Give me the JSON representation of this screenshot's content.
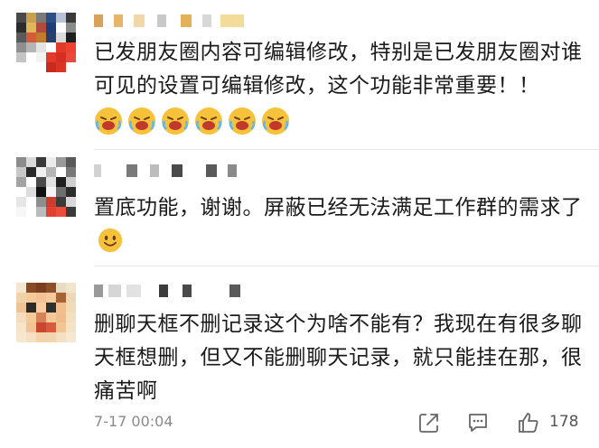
{
  "comments": [
    {
      "text": "已发朋友圈内容可编辑修改，特别是已发朋友圈对谁可见的设置可编辑修改，这个功能非常重要！！",
      "emojis": [
        "cry-laugh-emoji",
        "cry-laugh-emoji",
        "cry-laugh-emoji",
        "cry-laugh-emoji",
        "cry-laugh-emoji",
        "cry-laugh-emoji"
      ]
    },
    {
      "text": "置底功能，谢谢。屏蔽已经无法满足工作群的需求了",
      "trailing_emoji": "smile-emoji"
    },
    {
      "text": "删聊天框不删记录这个为啥不能有？我现在有很多聊天框想删，但又不能删聊天记录，就只能挂在那，很痛苦啊"
    }
  ],
  "footer": {
    "timestamp": "7-17 00:04",
    "share_icon": "share-icon",
    "comment_icon": "comment-icon",
    "like_icon": "thumbs-up-icon",
    "like_count": "178"
  },
  "colors": {
    "text": "#1a1a1a",
    "muted": "#8a8a8a",
    "emoji_yellow": "#f7c23b",
    "emoji_mouth": "#c0392b"
  }
}
